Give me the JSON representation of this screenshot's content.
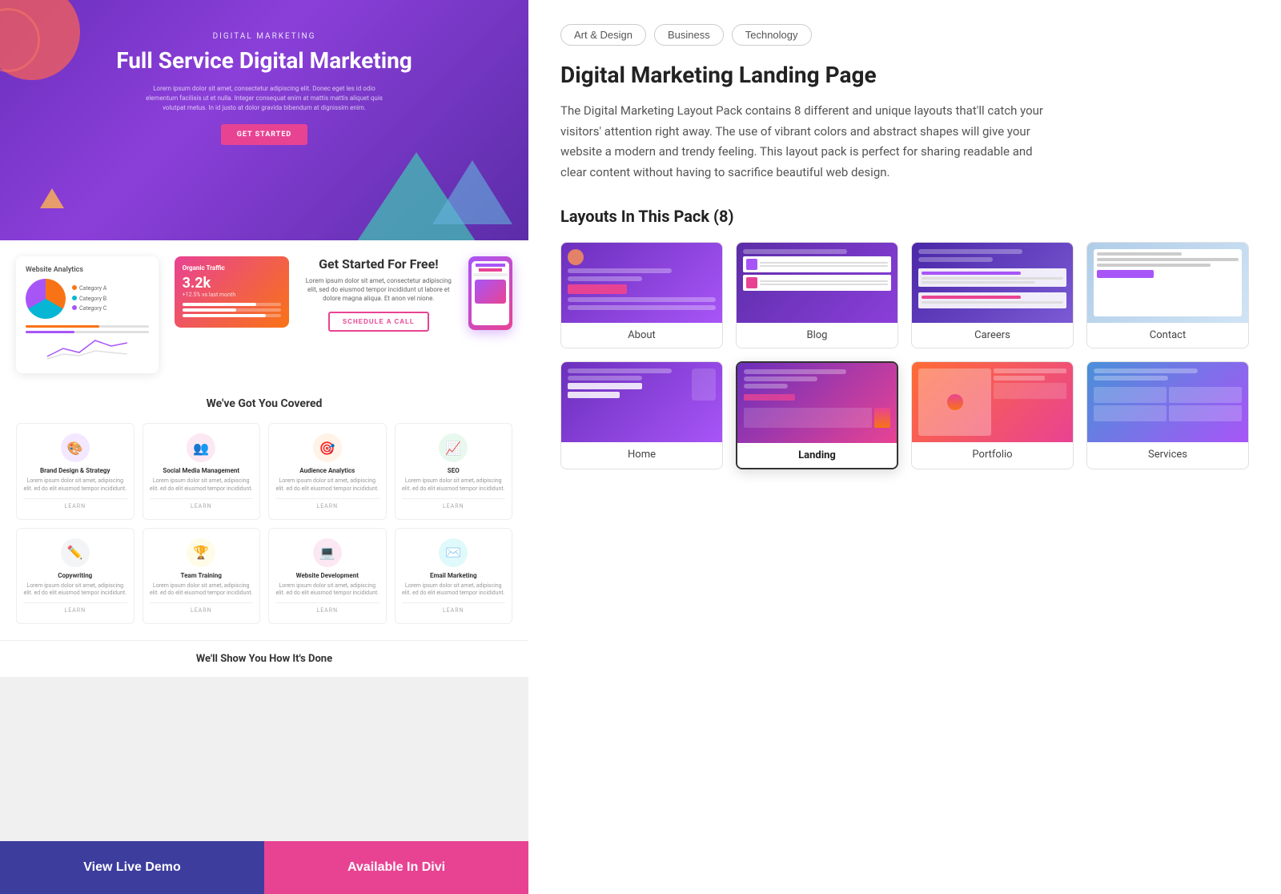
{
  "left": {
    "hero": {
      "subtitle": "DIGITAL MARKETING",
      "title": "Full Service Digital Marketing",
      "body": "Lorem ipsum dolor sit amet, consectetur adipiscing elit. Donec eget les id odio elementum facilisis ut et nulla. Integer consequat enim at mattis mattis aliquet quis volutpat metus. In id justo at dolor gravida bibendum at dignissim enim.",
      "cta": "GET STARTED"
    },
    "dashboard": {
      "card1_title": "Website Analytics",
      "cta_title": "Get Started For Free!",
      "cta_text": "Lorem ipsum dolor sit amet, consectetur adipiscing elit, sed do eiusmod tempor incididunt ut labore et dolore magna aliqua. Et anon vel nione.",
      "cta_button": "SCHEDULE A CALL",
      "traffic_label": "Organic Traffic",
      "traffic_num": "3.2k"
    },
    "services": {
      "title": "We've Got You Covered",
      "items": [
        {
          "name": "Brand Design & Strategy",
          "icon": "🎨",
          "color": "#a855f7",
          "bg": "#f3e8ff"
        },
        {
          "name": "Social Media Management",
          "icon": "👥",
          "color": "#e84393",
          "bg": "#fce8f3"
        },
        {
          "name": "Audience Analytics",
          "icon": "🎯",
          "color": "#f97316",
          "bg": "#fff3e8"
        },
        {
          "name": "SEO",
          "icon": "📈",
          "color": "#22c55e",
          "bg": "#e8f8ee"
        },
        {
          "name": "Copywriting",
          "icon": "✏️",
          "color": "#6b7280",
          "bg": "#f3f4f6"
        },
        {
          "name": "Team Training",
          "icon": "🏆",
          "color": "#eab308",
          "bg": "#fefce8"
        },
        {
          "name": "Website Development",
          "icon": "💻",
          "color": "#e84393",
          "bg": "#fce8f3"
        },
        {
          "name": "Email Marketing",
          "icon": "✉️",
          "color": "#06b6d4",
          "bg": "#e0f9fb"
        }
      ]
    },
    "how": {
      "title": "We'll Show You How It's Done"
    },
    "buttons": {
      "view_demo": "View Live Demo",
      "available_divi": "Available In Divi"
    }
  },
  "right": {
    "tags": [
      {
        "label": "Art & Design"
      },
      {
        "label": "Business"
      },
      {
        "label": "Technology"
      }
    ],
    "title": "Digital Marketing Landing Page",
    "description": "The Digital Marketing Layout Pack contains 8 different and unique layouts that'll catch your visitors' attention right away. The use of vibrant colors and abstract shapes will give your website a modern and trendy feeling. This layout pack is perfect for sharing readable and clear content without having to sacrifice beautiful web design.",
    "layouts_title": "Layouts In This Pack (8)",
    "layouts": [
      {
        "label": "About",
        "active": false
      },
      {
        "label": "Blog",
        "active": false
      },
      {
        "label": "Careers",
        "active": false
      },
      {
        "label": "Contact",
        "active": false
      },
      {
        "label": "Home",
        "active": false
      },
      {
        "label": "Landing",
        "active": true
      },
      {
        "label": "Portfolio",
        "active": false
      },
      {
        "label": "Services",
        "active": false
      }
    ]
  }
}
